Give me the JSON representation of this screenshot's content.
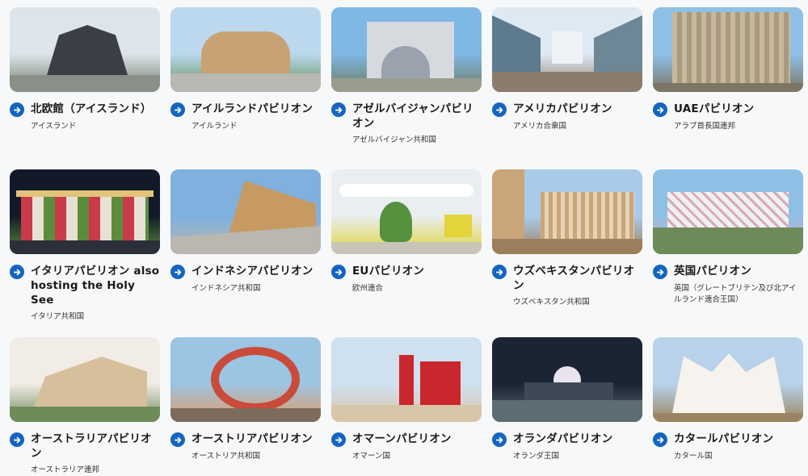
{
  "pavilions": [
    {
      "title": "北欧館（アイスランド）",
      "country": "アイスランド",
      "image": "nordic-pavilion-photo",
      "colors": [
        "#dde4ea",
        "#3b3f45",
        "#6f7d6a"
      ]
    },
    {
      "title": "アイルランドパビリオン",
      "country": "アイルランド",
      "image": "ireland-pavilion-photo",
      "colors": [
        "#bcd8ef",
        "#c9a273",
        "#5f8f4e"
      ]
    },
    {
      "title": "アゼルバイジャンパビリオン",
      "country": "アゼルバイジャン共和国",
      "image": "azerbaijan-pavilion-photo",
      "colors": [
        "#7fb7e5",
        "#d6d9de",
        "#6e7c5f"
      ]
    },
    {
      "title": "アメリカパビリオン",
      "country": "アメリカ合衆国",
      "image": "usa-pavilion-photo",
      "colors": [
        "#dfe9f4",
        "#8da3b9",
        "#8a7d6b"
      ]
    },
    {
      "title": "UAEパビリオン",
      "country": "アラブ首長国連邦",
      "image": "uae-pavilion-photo",
      "colors": [
        "#8fc1e8",
        "#c8b89b",
        "#7d7566"
      ]
    },
    {
      "title": "イタリアパビリオン also hosting the Holy See",
      "country": "イタリア共和国",
      "image": "italy-pavilion-photo",
      "colors": [
        "#121a2a",
        "#e3c27a",
        "#5b8c3c"
      ]
    },
    {
      "title": "インドネシアパビリオン",
      "country": "インドネシア共和国",
      "image": "indonesia-pavilion-photo",
      "colors": [
        "#7fb0de",
        "#c79a62",
        "#b9b7b0"
      ]
    },
    {
      "title": "EUパビリオン",
      "country": "欧州連合",
      "image": "eu-pavilion-photo",
      "colors": [
        "#e9eef0",
        "#55913f",
        "#e2d43a"
      ]
    },
    {
      "title": "ウズベキスタンパビリオン",
      "country": "ウズベキスタン共和国",
      "image": "uzbekistan-pavilion-photo",
      "colors": [
        "#a9cbe9",
        "#caa57a",
        "#9c7e5c"
      ]
    },
    {
      "title": "英国パビリオン",
      "country": "英国（グレートブリテン及び北アイルランド連合王国）",
      "image": "uk-pavilion-photo",
      "colors": [
        "#8ec0e6",
        "#eef0f2",
        "#d9a9b5"
      ]
    },
    {
      "title": "オーストラリアパビリオン",
      "country": "オーストラリア連邦",
      "image": "australia-pavilion-photo",
      "colors": [
        "#f1ece6",
        "#d6c09c",
        "#6e8b58"
      ]
    },
    {
      "title": "オーストリアパビリオン",
      "country": "オーストリア共和国",
      "image": "austria-pavilion-photo",
      "colors": [
        "#9cc4e3",
        "#c94b3a",
        "#e29a62"
      ]
    },
    {
      "title": "オマーンパビリオン",
      "country": "オマーン国",
      "image": "oman-pavilion-photo",
      "colors": [
        "#cfe1ef",
        "#c9272d",
        "#d8c6a8"
      ]
    },
    {
      "title": "オランダパビリオン",
      "country": "オランダ王国",
      "image": "netherlands-pavilion-photo",
      "colors": [
        "#1a2433",
        "#e9e4ef",
        "#5d6b72"
      ]
    },
    {
      "title": "カタールパビリオン",
      "country": "カタール国",
      "image": "qatar-pavilion-photo",
      "colors": [
        "#b8d2ea",
        "#f6f3ee",
        "#9b8560"
      ]
    }
  ]
}
